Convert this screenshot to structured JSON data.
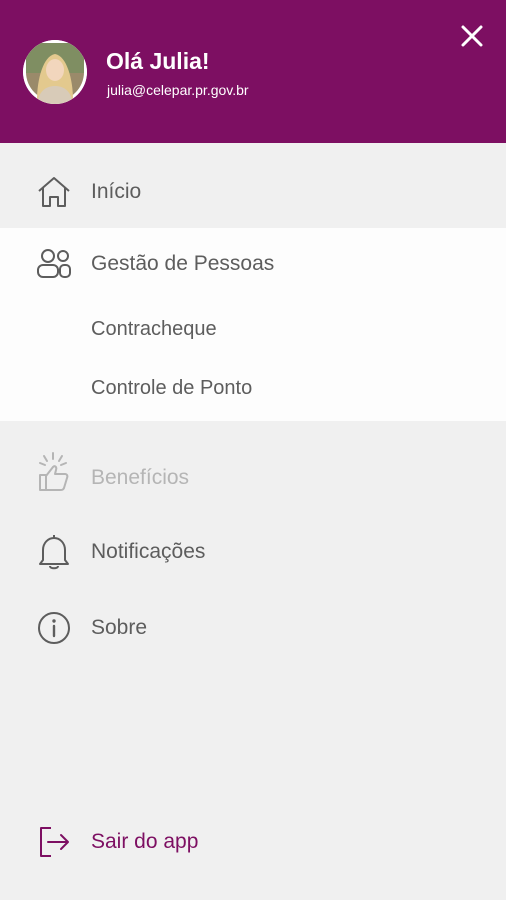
{
  "header": {
    "greeting": "Olá Julia!",
    "email": "julia@celepar.pr.gov.br",
    "avatar_icon": "user-avatar",
    "close_icon": "close-icon"
  },
  "menu": {
    "inicio": {
      "label": "Início",
      "icon": "home-icon"
    },
    "gestao": {
      "label": "Gestão de Pessoas",
      "icon": "people-icon",
      "children": [
        {
          "label": "Contracheque"
        },
        {
          "label": "Controle de Ponto"
        }
      ]
    },
    "beneficios": {
      "label": "Benefícios",
      "icon": "thumbs-up-icon",
      "disabled": true
    },
    "notificacoes": {
      "label": "Notificações",
      "icon": "bell-icon"
    },
    "sobre": {
      "label": "Sobre",
      "icon": "info-icon"
    }
  },
  "logout": {
    "label": "Sair do app",
    "icon": "logout-icon"
  },
  "colors": {
    "brand": "#7d0f62",
    "background": "#f0f0f0",
    "text": "#5d5d5d",
    "disabled_text": "#b5b5b5"
  }
}
